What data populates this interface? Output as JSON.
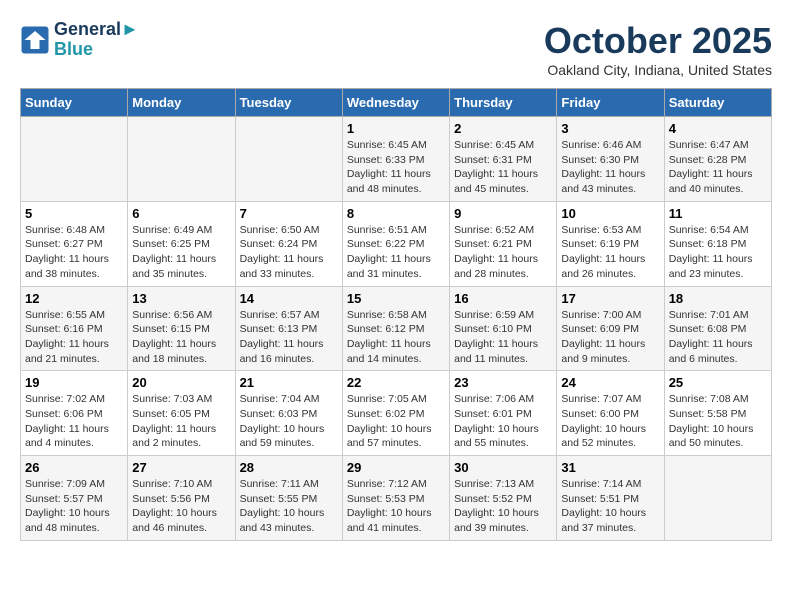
{
  "header": {
    "logo_line1": "General",
    "logo_line2": "Blue",
    "month": "October 2025",
    "location": "Oakland City, Indiana, United States"
  },
  "days_of_week": [
    "Sunday",
    "Monday",
    "Tuesday",
    "Wednesday",
    "Thursday",
    "Friday",
    "Saturday"
  ],
  "weeks": [
    [
      {
        "num": "",
        "info": ""
      },
      {
        "num": "",
        "info": ""
      },
      {
        "num": "",
        "info": ""
      },
      {
        "num": "1",
        "info": "Sunrise: 6:45 AM\nSunset: 6:33 PM\nDaylight: 11 hours and 48 minutes."
      },
      {
        "num": "2",
        "info": "Sunrise: 6:45 AM\nSunset: 6:31 PM\nDaylight: 11 hours and 45 minutes."
      },
      {
        "num": "3",
        "info": "Sunrise: 6:46 AM\nSunset: 6:30 PM\nDaylight: 11 hours and 43 minutes."
      },
      {
        "num": "4",
        "info": "Sunrise: 6:47 AM\nSunset: 6:28 PM\nDaylight: 11 hours and 40 minutes."
      }
    ],
    [
      {
        "num": "5",
        "info": "Sunrise: 6:48 AM\nSunset: 6:27 PM\nDaylight: 11 hours and 38 minutes."
      },
      {
        "num": "6",
        "info": "Sunrise: 6:49 AM\nSunset: 6:25 PM\nDaylight: 11 hours and 35 minutes."
      },
      {
        "num": "7",
        "info": "Sunrise: 6:50 AM\nSunset: 6:24 PM\nDaylight: 11 hours and 33 minutes."
      },
      {
        "num": "8",
        "info": "Sunrise: 6:51 AM\nSunset: 6:22 PM\nDaylight: 11 hours and 31 minutes."
      },
      {
        "num": "9",
        "info": "Sunrise: 6:52 AM\nSunset: 6:21 PM\nDaylight: 11 hours and 28 minutes."
      },
      {
        "num": "10",
        "info": "Sunrise: 6:53 AM\nSunset: 6:19 PM\nDaylight: 11 hours and 26 minutes."
      },
      {
        "num": "11",
        "info": "Sunrise: 6:54 AM\nSunset: 6:18 PM\nDaylight: 11 hours and 23 minutes."
      }
    ],
    [
      {
        "num": "12",
        "info": "Sunrise: 6:55 AM\nSunset: 6:16 PM\nDaylight: 11 hours and 21 minutes."
      },
      {
        "num": "13",
        "info": "Sunrise: 6:56 AM\nSunset: 6:15 PM\nDaylight: 11 hours and 18 minutes."
      },
      {
        "num": "14",
        "info": "Sunrise: 6:57 AM\nSunset: 6:13 PM\nDaylight: 11 hours and 16 minutes."
      },
      {
        "num": "15",
        "info": "Sunrise: 6:58 AM\nSunset: 6:12 PM\nDaylight: 11 hours and 14 minutes."
      },
      {
        "num": "16",
        "info": "Sunrise: 6:59 AM\nSunset: 6:10 PM\nDaylight: 11 hours and 11 minutes."
      },
      {
        "num": "17",
        "info": "Sunrise: 7:00 AM\nSunset: 6:09 PM\nDaylight: 11 hours and 9 minutes."
      },
      {
        "num": "18",
        "info": "Sunrise: 7:01 AM\nSunset: 6:08 PM\nDaylight: 11 hours and 6 minutes."
      }
    ],
    [
      {
        "num": "19",
        "info": "Sunrise: 7:02 AM\nSunset: 6:06 PM\nDaylight: 11 hours and 4 minutes."
      },
      {
        "num": "20",
        "info": "Sunrise: 7:03 AM\nSunset: 6:05 PM\nDaylight: 11 hours and 2 minutes."
      },
      {
        "num": "21",
        "info": "Sunrise: 7:04 AM\nSunset: 6:03 PM\nDaylight: 10 hours and 59 minutes."
      },
      {
        "num": "22",
        "info": "Sunrise: 7:05 AM\nSunset: 6:02 PM\nDaylight: 10 hours and 57 minutes."
      },
      {
        "num": "23",
        "info": "Sunrise: 7:06 AM\nSunset: 6:01 PM\nDaylight: 10 hours and 55 minutes."
      },
      {
        "num": "24",
        "info": "Sunrise: 7:07 AM\nSunset: 6:00 PM\nDaylight: 10 hours and 52 minutes."
      },
      {
        "num": "25",
        "info": "Sunrise: 7:08 AM\nSunset: 5:58 PM\nDaylight: 10 hours and 50 minutes."
      }
    ],
    [
      {
        "num": "26",
        "info": "Sunrise: 7:09 AM\nSunset: 5:57 PM\nDaylight: 10 hours and 48 minutes."
      },
      {
        "num": "27",
        "info": "Sunrise: 7:10 AM\nSunset: 5:56 PM\nDaylight: 10 hours and 46 minutes."
      },
      {
        "num": "28",
        "info": "Sunrise: 7:11 AM\nSunset: 5:55 PM\nDaylight: 10 hours and 43 minutes."
      },
      {
        "num": "29",
        "info": "Sunrise: 7:12 AM\nSunset: 5:53 PM\nDaylight: 10 hours and 41 minutes."
      },
      {
        "num": "30",
        "info": "Sunrise: 7:13 AM\nSunset: 5:52 PM\nDaylight: 10 hours and 39 minutes."
      },
      {
        "num": "31",
        "info": "Sunrise: 7:14 AM\nSunset: 5:51 PM\nDaylight: 10 hours and 37 minutes."
      },
      {
        "num": "",
        "info": ""
      }
    ]
  ]
}
